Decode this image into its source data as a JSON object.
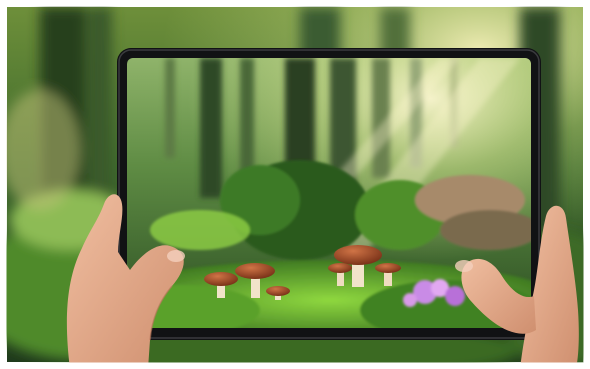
{
  "scene": {
    "subject": "hands-holding-tablet-in-forest",
    "palette": {
      "forest_dark": "#1f3a1c",
      "forest_mid": "#3f6d2c",
      "moss_bright": "#7fc93a",
      "sunlight": "#f4f0b8",
      "tablet_bezel": "#111214",
      "skin": "#e3a98a",
      "mushroom_cap": "#a54e2c",
      "mushroom_stem": "#f1e3c9",
      "flowers": "#c98be6"
    },
    "icons": [
      "tablet-icon",
      "mushroom-icon",
      "hand-icon"
    ]
  }
}
